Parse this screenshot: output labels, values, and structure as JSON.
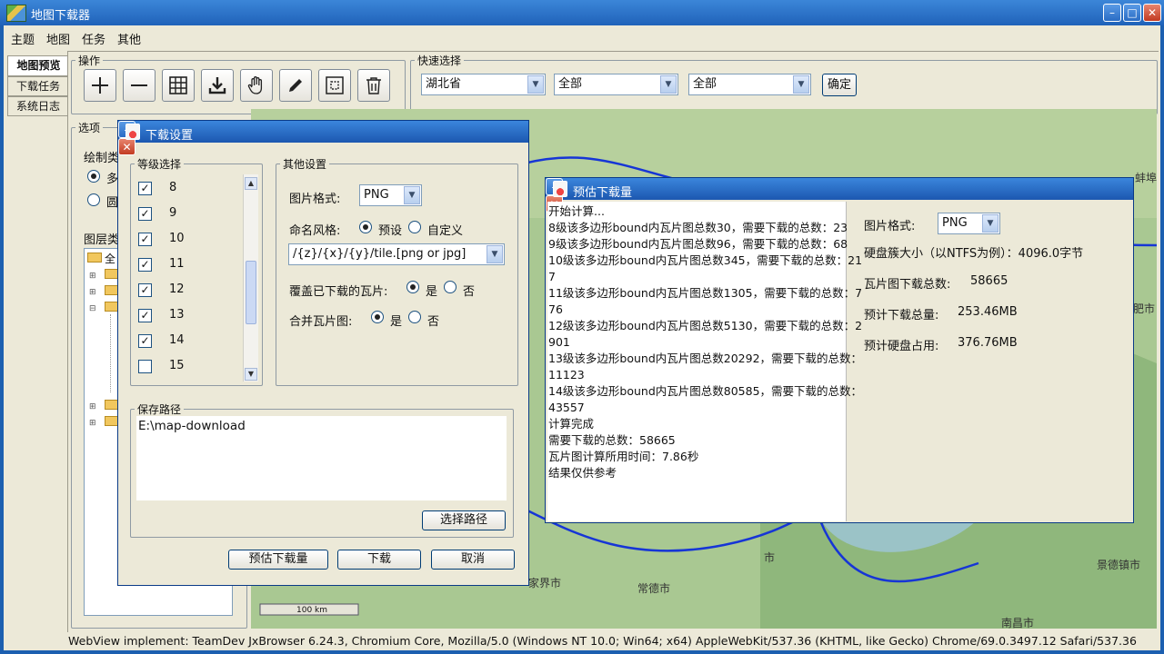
{
  "app": {
    "title": "地图下载器"
  },
  "menu": [
    "主题",
    "地图",
    "任务",
    "其他"
  ],
  "tabs": [
    "地图预览",
    "下载任务",
    "系统日志"
  ],
  "ops": {
    "legend": "操作",
    "buttons": [
      "add-icon",
      "minus-icon",
      "grid-icon",
      "download-icon",
      "hand-icon",
      "pencil-icon",
      "select-region-icon",
      "trash-icon"
    ]
  },
  "quick": {
    "legend": "快速选择",
    "province": "湖北省",
    "city": "全部",
    "district": "全部",
    "confirm": "确定"
  },
  "options": {
    "legend": "选项",
    "draw_type": "绘制类",
    "radio1": "多",
    "radio2": "圆",
    "layers": "图层类",
    "tree_root": "全"
  },
  "map": {
    "scale_label": "100 km",
    "places": [
      "常德市",
      "南昌市",
      "景德镇市",
      "家界市",
      "市",
      "蚌埠",
      "肥市"
    ]
  },
  "status": "WebView implement:  TeamDev JxBrowser 6.24.3, Chromium Core, Mozilla/5.0 (Windows NT 10.0; Win64; x64) AppleWebKit/537.36 (KHTML, like Gecko) Chrome/69.0.3497.12 Safari/537.36",
  "download_dialog": {
    "title": "下载设置",
    "levels_legend": "等级选择",
    "levels": [
      {
        "label": "8",
        "checked": true
      },
      {
        "label": "9",
        "checked": true
      },
      {
        "label": "10",
        "checked": true
      },
      {
        "label": "11",
        "checked": true
      },
      {
        "label": "12",
        "checked": true
      },
      {
        "label": "13",
        "checked": true
      },
      {
        "label": "14",
        "checked": true
      },
      {
        "label": "15",
        "checked": false
      }
    ],
    "other_legend": "其他设置",
    "format_label": "图片格式:",
    "format_value": "PNG",
    "naming_label": "命名风格:",
    "naming_preset": "预设",
    "naming_custom": "自定义",
    "naming_pattern": "/{z}/{x}/{y}/tile.[png or jpg]",
    "overwrite_label": "覆盖已下载的瓦片:",
    "merge_label": "合并瓦片图:",
    "yes": "是",
    "no": "否",
    "save_legend": "保存路径",
    "save_path": "E:\\map-download",
    "choose_path": "选择路径",
    "estimate": "预估下载量",
    "download": "下载",
    "cancel": "取消"
  },
  "estimate_dialog": {
    "title": "预估下载量",
    "log": [
      "开始计算...",
      "8级该多边形bound内瓦片图总数30，需要下载的总数：23",
      "9级该多边形bound内瓦片图总数96，需要下载的总数：68",
      "10级该多边形bound内瓦片图总数345，需要下载的总数：21",
      "7",
      "11级该多边形bound内瓦片图总数1305，需要下载的总数：7",
      "76",
      "12级该多边形bound内瓦片图总数5130，需要下载的总数：2",
      "901",
      "13级该多边形bound内瓦片图总数20292，需要下载的总数：",
      "11123",
      "14级该多边形bound内瓦片图总数80585，需要下载的总数：",
      "43557",
      "计算完成",
      "需要下载的总数：58665",
      "瓦片图计算所用时间：7.86秒",
      "结果仅供参考"
    ],
    "format_label": "图片格式:",
    "format_value": "PNG",
    "cluster_label": "硬盘簇大小（以NTFS为例）：4096.0字节",
    "tiles_label": "瓦片图下载总数:",
    "tiles_value": "58665",
    "total_label": "预计下载总量:",
    "total_value": "253.46MB",
    "disk_label": "预计硬盘占用:",
    "disk_value": "376.76MB"
  }
}
